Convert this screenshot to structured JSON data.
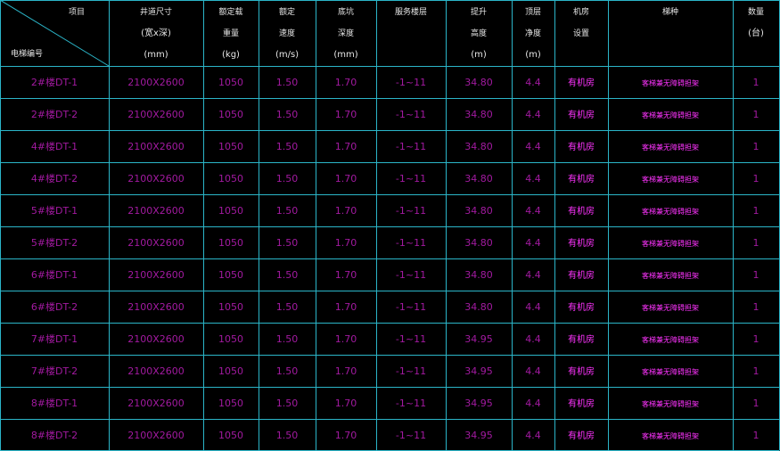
{
  "colors": {
    "background": "#000000",
    "grid_line": "#2bb5c8",
    "header_text": "#e6e6e6",
    "cell_purple": "#a21aa0",
    "cell_magenta": "#ff33ff"
  },
  "header": {
    "corner_top": "项目",
    "corner_bottom": "电梯编号",
    "columns": [
      {
        "key": "shaft",
        "lines": [
          "井道尺寸",
          "(宽x深)",
          "(mm)"
        ]
      },
      {
        "key": "load",
        "lines": [
          "额定载",
          "重量",
          "(kg)"
        ]
      },
      {
        "key": "speed",
        "lines": [
          "额定",
          "速度",
          "(m/s)"
        ]
      },
      {
        "key": "pit",
        "lines": [
          "底坑",
          "深度",
          "(mm)"
        ]
      },
      {
        "key": "floors",
        "lines": [
          "服务楼层",
          "",
          ""
        ]
      },
      {
        "key": "rise",
        "lines": [
          "提升",
          "高度",
          "(m)"
        ]
      },
      {
        "key": "overhead",
        "lines": [
          "顶层",
          "净度",
          "(m)"
        ]
      },
      {
        "key": "machine",
        "lines": [
          "机房",
          "设置",
          ""
        ]
      },
      {
        "key": "type",
        "lines": [
          "梯种",
          "",
          ""
        ]
      },
      {
        "key": "qty",
        "lines": [
          "数量",
          "(台)",
          ""
        ]
      }
    ]
  },
  "rows": [
    {
      "id": "2#楼DT-1",
      "shaft": "2100X2600",
      "load": "1050",
      "speed": "1.50",
      "pit": "1.70",
      "floors": "-1~11",
      "rise": "34.80",
      "overhead": "4.4",
      "machine": "有机房",
      "type": "客梯兼无障碍担架",
      "qty": "1"
    },
    {
      "id": "2#楼DT-2",
      "shaft": "2100X2600",
      "load": "1050",
      "speed": "1.50",
      "pit": "1.70",
      "floors": "-1~11",
      "rise": "34.80",
      "overhead": "4.4",
      "machine": "有机房",
      "type": "客梯兼无障碍担架",
      "qty": "1"
    },
    {
      "id": "4#楼DT-1",
      "shaft": "2100X2600",
      "load": "1050",
      "speed": "1.50",
      "pit": "1.70",
      "floors": "-1~11",
      "rise": "34.80",
      "overhead": "4.4",
      "machine": "有机房",
      "type": "客梯兼无障碍担架",
      "qty": "1"
    },
    {
      "id": "4#楼DT-2",
      "shaft": "2100X2600",
      "load": "1050",
      "speed": "1.50",
      "pit": "1.70",
      "floors": "-1~11",
      "rise": "34.80",
      "overhead": "4.4",
      "machine": "有机房",
      "type": "客梯兼无障碍担架",
      "qty": "1"
    },
    {
      "id": "5#楼DT-1",
      "shaft": "2100X2600",
      "load": "1050",
      "speed": "1.50",
      "pit": "1.70",
      "floors": "-1~11",
      "rise": "34.80",
      "overhead": "4.4",
      "machine": "有机房",
      "type": "客梯兼无障碍担架",
      "qty": "1"
    },
    {
      "id": "5#楼DT-2",
      "shaft": "2100X2600",
      "load": "1050",
      "speed": "1.50",
      "pit": "1.70",
      "floors": "-1~11",
      "rise": "34.80",
      "overhead": "4.4",
      "machine": "有机房",
      "type": "客梯兼无障碍担架",
      "qty": "1"
    },
    {
      "id": "6#楼DT-1",
      "shaft": "2100X2600",
      "load": "1050",
      "speed": "1.50",
      "pit": "1.70",
      "floors": "-1~11",
      "rise": "34.80",
      "overhead": "4.4",
      "machine": "有机房",
      "type": "客梯兼无障碍担架",
      "qty": "1"
    },
    {
      "id": "6#楼DT-2",
      "shaft": "2100X2600",
      "load": "1050",
      "speed": "1.50",
      "pit": "1.70",
      "floors": "-1~11",
      "rise": "34.80",
      "overhead": "4.4",
      "machine": "有机房",
      "type": "客梯兼无障碍担架",
      "qty": "1"
    },
    {
      "id": "7#楼DT-1",
      "shaft": "2100X2600",
      "load": "1050",
      "speed": "1.50",
      "pit": "1.70",
      "floors": "-1~11",
      "rise": "34.95",
      "overhead": "4.4",
      "machine": "有机房",
      "type": "客梯兼无障碍担架",
      "qty": "1"
    },
    {
      "id": "7#楼DT-2",
      "shaft": "2100X2600",
      "load": "1050",
      "speed": "1.50",
      "pit": "1.70",
      "floors": "-1~11",
      "rise": "34.95",
      "overhead": "4.4",
      "machine": "有机房",
      "type": "客梯兼无障碍担架",
      "qty": "1"
    },
    {
      "id": "8#楼DT-1",
      "shaft": "2100X2600",
      "load": "1050",
      "speed": "1.50",
      "pit": "1.70",
      "floors": "-1~11",
      "rise": "34.95",
      "overhead": "4.4",
      "machine": "有机房",
      "type": "客梯兼无障碍担架",
      "qty": "1"
    },
    {
      "id": "8#楼DT-2",
      "shaft": "2100X2600",
      "load": "1050",
      "speed": "1.50",
      "pit": "1.70",
      "floors": "-1~11",
      "rise": "34.95",
      "overhead": "4.4",
      "machine": "有机房",
      "type": "客梯兼无障碍担架",
      "qty": "1"
    }
  ]
}
